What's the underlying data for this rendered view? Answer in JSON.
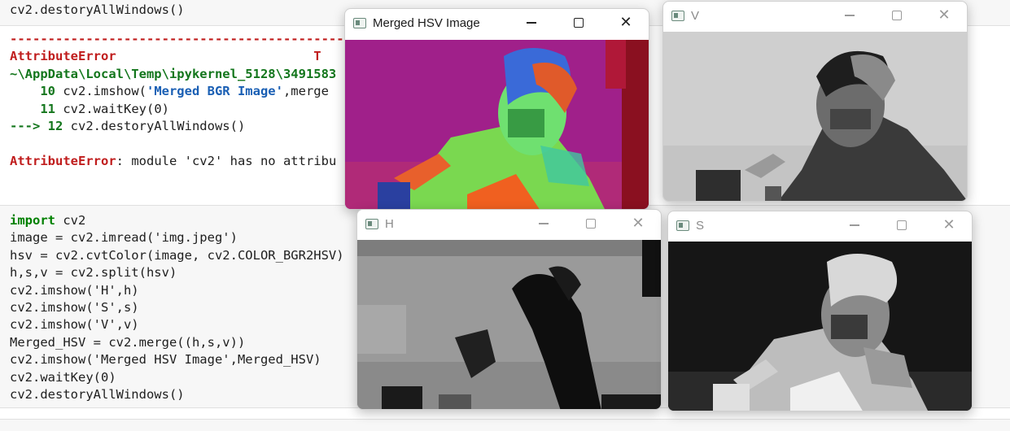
{
  "notebook": {
    "prev_cell_line": "cv2.destoryAllWindows()",
    "error": {
      "dashes": "------------------------------------------------",
      "name": "AttributeError",
      "right_fragment": "T",
      "path": "~\\AppData\\Local\\Temp\\ipykernel_5128\\3491583",
      "line10_num": "10",
      "line10_code_pre": " cv2.imshow(",
      "line10_str": "'Merged BGR Image'",
      "line10_code_post": ",merge",
      "line11_num": "11",
      "line11_code": " cv2.waitKey(0)",
      "line12_arrow": "---> 12",
      "line12_code": " cv2.destoryAllWindows()",
      "message_name": "AttributeError",
      "message_text": ": module 'cv2' has no attribu"
    },
    "code_cell": {
      "lines": [
        "import cv2",
        "image = cv2.imread('img.jpeg')",
        "hsv = cv2.cvtColor(image, cv2.COLOR_BGR2HSV)",
        "h,s,v = cv2.split(hsv)",
        "cv2.imshow('H',h)",
        "cv2.imshow('S',s)",
        "cv2.imshow('V',v)",
        "Merged_HSV = cv2.merge((h,s,v))",
        "cv2.imshow('Merged HSV Image',Merged_HSV)",
        "cv2.waitKey(0)",
        "cv2.destoryAllWindows()"
      ]
    }
  },
  "windows": {
    "merged": {
      "title": "Merged HSV Image",
      "state": "active"
    },
    "v": {
      "title": "V",
      "state": "inactive"
    },
    "h": {
      "title": "H",
      "state": "inactive"
    },
    "s": {
      "title": "S",
      "state": "inactive"
    }
  },
  "icons": {
    "app": "window-app-icon",
    "minimize": "minimize-icon",
    "maximize": "maximize-icon",
    "close": "close-icon"
  },
  "colors": {
    "error_red": "#c01d1d",
    "path_green": "#13761c",
    "string_red": "#ba2121",
    "keyword_green": "#008000",
    "merged_bg_magenta": "#a0208a"
  }
}
